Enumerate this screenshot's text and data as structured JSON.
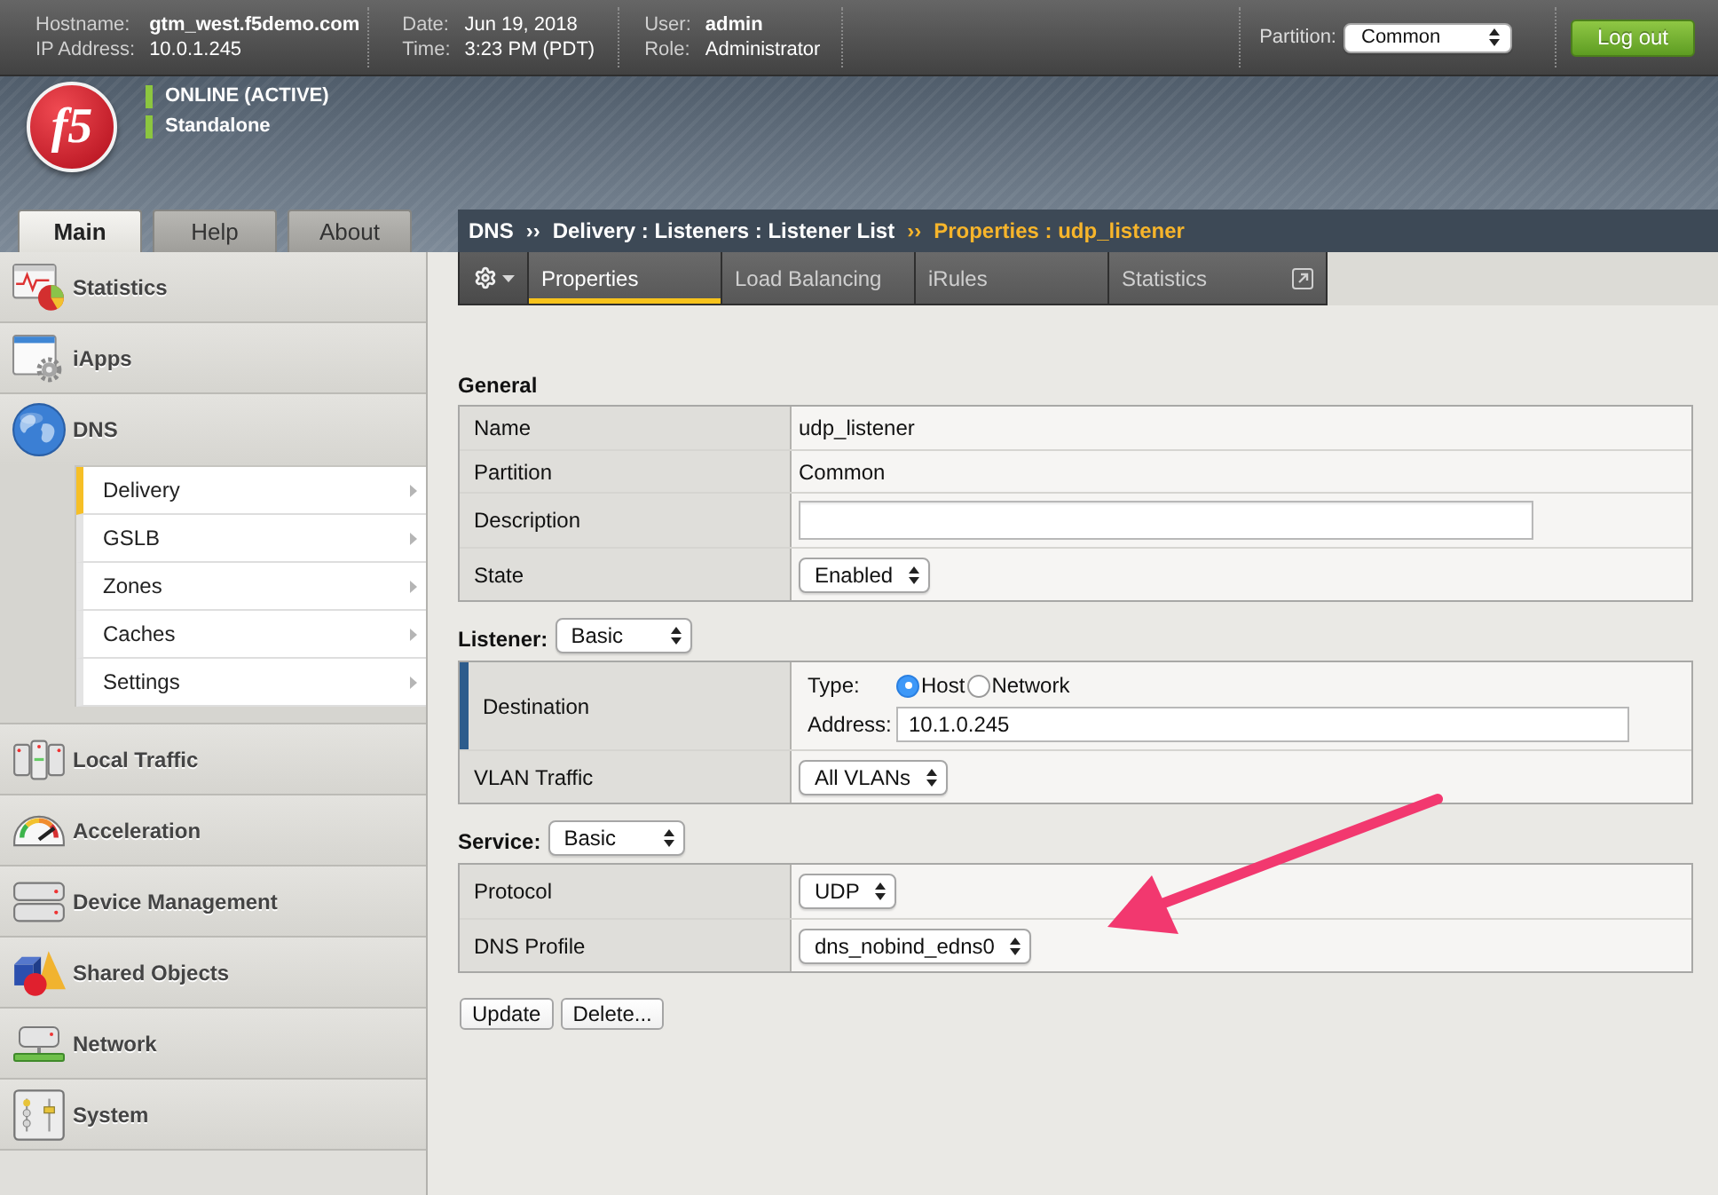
{
  "top_bar": {
    "info_groups": [
      [
        {
          "label": "Hostname:",
          "value": "gtm_west.f5demo.com",
          "bold": true
        },
        {
          "label": "IP Address:",
          "value": "10.0.1.245",
          "bold": false
        }
      ],
      [
        {
          "label": "Date:",
          "value": "Jun 19, 2018",
          "bold": false
        },
        {
          "label": "Time:",
          "value": "3:23 PM (PDT)",
          "bold": false
        }
      ],
      [
        {
          "label": "User:",
          "value": "admin",
          "bold": true
        },
        {
          "label": "Role:",
          "value": "Administrator",
          "bold": false
        }
      ]
    ],
    "partition": {
      "label": "Partition:",
      "value": "Common"
    },
    "logout_button": "Log out"
  },
  "banner": {
    "logo": "f5",
    "status_lines": [
      "ONLINE (ACTIVE)",
      "Standalone"
    ]
  },
  "nav_tabs": [
    {
      "label": "Main",
      "selected": true
    },
    {
      "label": "Help",
      "selected": false
    },
    {
      "label": "About",
      "selected": false
    }
  ],
  "sidebar": {
    "items": [
      {
        "label": "Statistics",
        "expanded": false
      },
      {
        "label": "iApps",
        "expanded": false
      },
      {
        "label": "DNS",
        "expanded": true,
        "children": [
          {
            "label": "Delivery",
            "selected": true
          },
          {
            "label": "GSLB",
            "selected": false
          },
          {
            "label": "Zones",
            "selected": false
          },
          {
            "label": "Caches",
            "selected": false
          },
          {
            "label": "Settings",
            "selected": false
          }
        ]
      },
      {
        "label": "Local Traffic",
        "expanded": false
      },
      {
        "label": "Acceleration",
        "expanded": false
      },
      {
        "label": "Device Management",
        "expanded": false
      },
      {
        "label": "Shared Objects",
        "expanded": false
      },
      {
        "label": "Network",
        "expanded": false
      },
      {
        "label": "System",
        "expanded": false
      }
    ]
  },
  "breadcrumb": {
    "items": [
      {
        "label": "DNS",
        "selected": false
      },
      {
        "label": "Delivery : Listeners : Listener List",
        "selected": false
      },
      {
        "label": "Properties : udp_listener",
        "selected": true
      }
    ],
    "separators": [
      "››",
      "››"
    ]
  },
  "tabs": [
    {
      "label": "Properties",
      "selected": true,
      "external": false
    },
    {
      "label": "Load Balancing",
      "selected": false,
      "external": false
    },
    {
      "label": "iRules",
      "selected": false,
      "external": false
    },
    {
      "label": "Statistics",
      "selected": false,
      "external": true
    }
  ],
  "sections": [
    {
      "title": "General",
      "rows": [
        {
          "label": "Name",
          "kind": "text",
          "value": "udp_listener",
          "marked": false
        },
        {
          "label": "Partition",
          "kind": "text",
          "value": "Common",
          "marked": false
        },
        {
          "label": "Description",
          "kind": "input",
          "marked": false
        },
        {
          "label": "State",
          "kind": "select",
          "value": "Enabled",
          "marked": false
        }
      ]
    },
    {
      "title": "Listener:",
      "mode": "Basic",
      "rows": [
        {
          "label": "Destination",
          "kind": "destination",
          "marked": true,
          "type_label": "Type:",
          "options": [
            {
              "label": "Host",
              "selected": true
            },
            {
              "label": "Network",
              "selected": false
            }
          ],
          "address_label": "Address:",
          "address": "10.1.0.245"
        },
        {
          "label": "VLAN Traffic",
          "kind": "select",
          "value": "All VLANs",
          "marked": false
        }
      ]
    },
    {
      "title": "Service:",
      "mode": "Basic",
      "rows": [
        {
          "label": "Protocol",
          "kind": "select",
          "value": "UDP",
          "marked": false
        },
        {
          "label": "DNS Profile",
          "kind": "select",
          "value": "dns_nobind_edns0",
          "marked": false
        }
      ]
    }
  ],
  "buttons": [
    "Update",
    "Delete..."
  ]
}
